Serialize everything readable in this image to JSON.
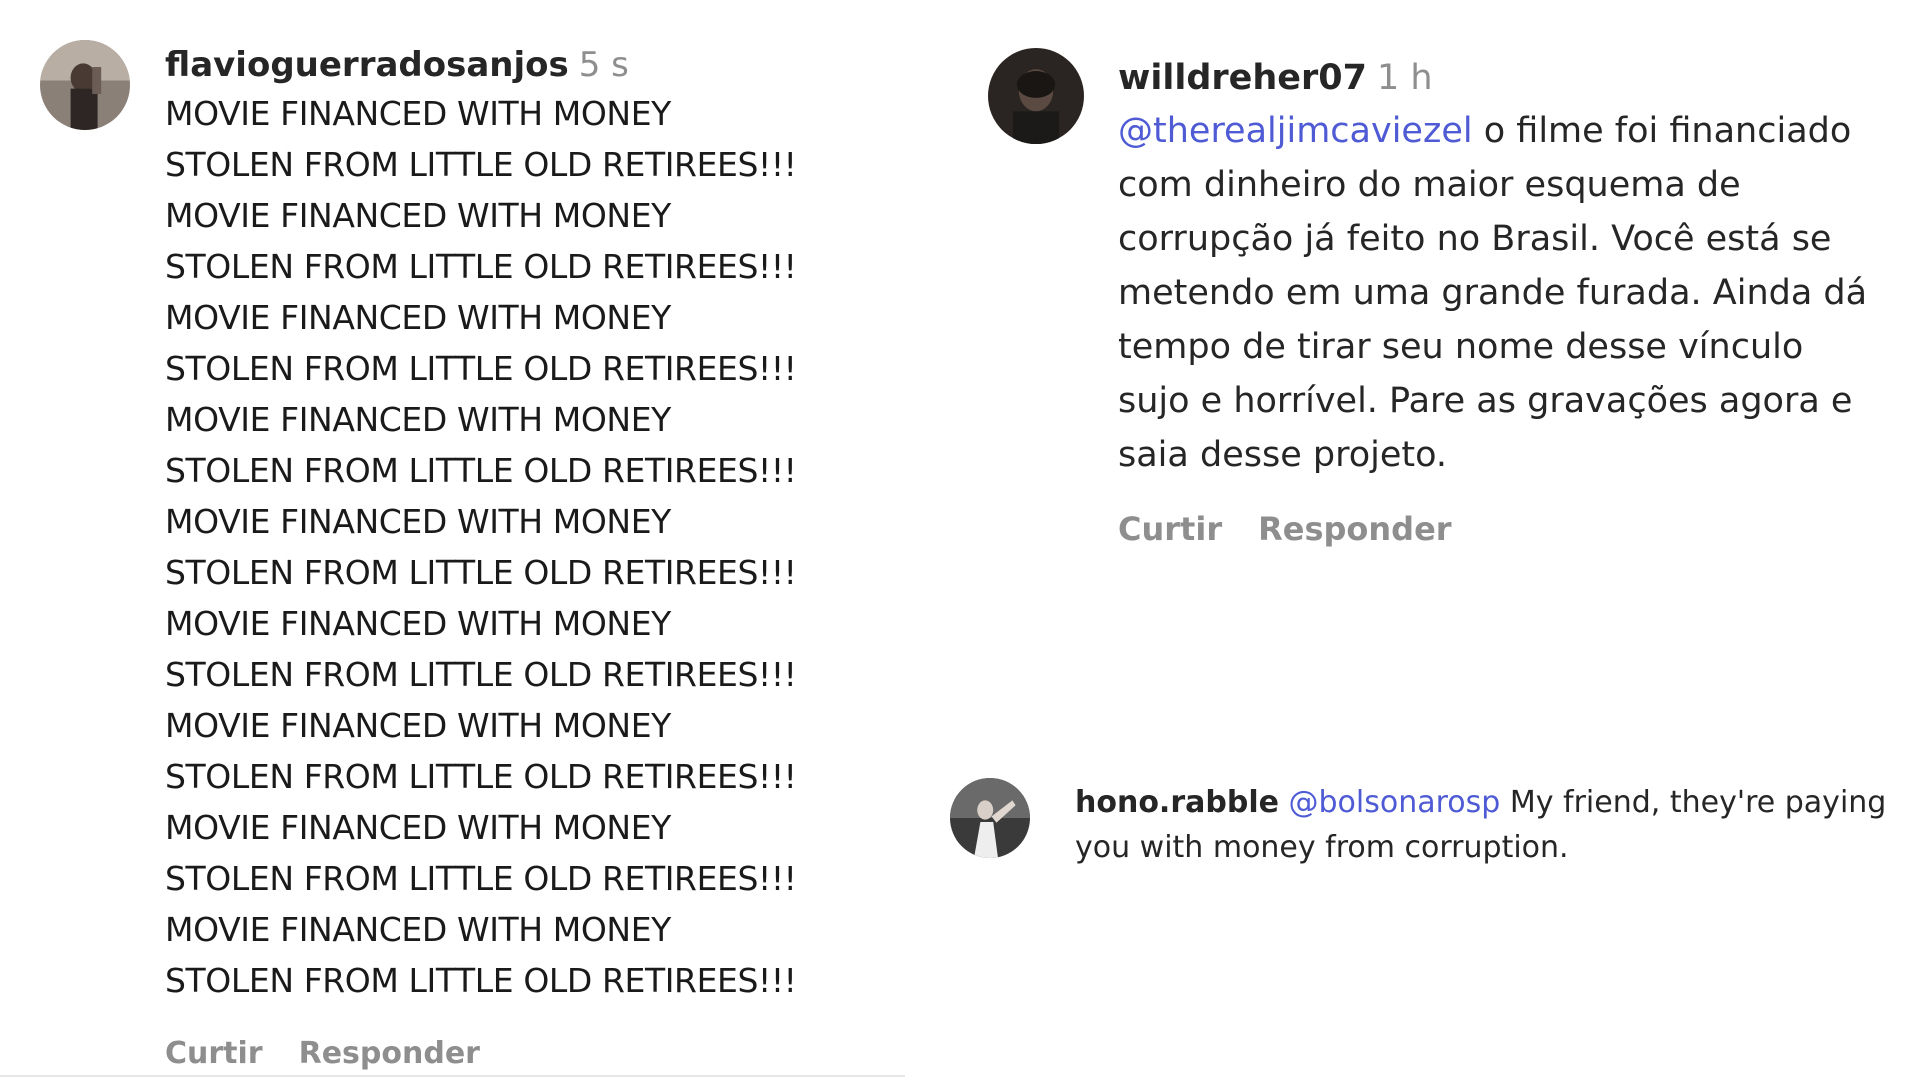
{
  "comments": [
    {
      "username": "flavioguerradosanjos",
      "time": "5 s",
      "lines": [
        "MOVIE FINANCED WITH MONEY",
        "STOLEN FROM LITTLE OLD RETIREES!!!",
        "MOVIE FINANCED WITH MONEY",
        "STOLEN FROM LITTLE OLD RETIREES!!!",
        "MOVIE FINANCED WITH MONEY",
        "STOLEN FROM LITTLE OLD RETIREES!!!",
        "MOVIE FINANCED WITH MONEY",
        "STOLEN FROM LITTLE OLD RETIREES!!!",
        "MOVIE FINANCED WITH MONEY",
        "STOLEN FROM LITTLE OLD RETIREES!!!",
        "MOVIE FINANCED WITH MONEY",
        "STOLEN FROM LITTLE OLD RETIREES!!!",
        "MOVIE FINANCED WITH MONEY",
        "STOLEN FROM LITTLE OLD RETIREES!!!",
        "MOVIE FINANCED WITH MONEY",
        "STOLEN FROM LITTLE OLD RETIREES!!!",
        "MOVIE FINANCED WITH MONEY",
        "STOLEN FROM LITTLE OLD RETIREES!!!"
      ],
      "like_label": "Curtir",
      "reply_label": "Responder"
    },
    {
      "username": "willdreher07",
      "time": "1 h",
      "mention": "@therealjimcaviezel",
      "text": " o filme foi financiado com dinheiro do maior esquema de corrupção já feito no Brasil. Você está se metendo em uma grande furada. Ainda dá tempo de tirar seu nome desse vínculo sujo e horrível. Pare as gravações agora e saia desse projeto.",
      "like_label": "Curtir",
      "reply_label": "Responder"
    },
    {
      "username": "hono.rabble",
      "mention": "@bolsonarosp",
      "text": " My friend, they're paying you with money from corruption."
    }
  ],
  "colors": {
    "mention": "#4f5bd5",
    "muted": "#8e8e8e",
    "text": "#262626"
  },
  "icons": {
    "avatar1": "user-photo-avatar",
    "avatar2": "user-photo-avatar",
    "avatar3": "user-photo-avatar"
  }
}
